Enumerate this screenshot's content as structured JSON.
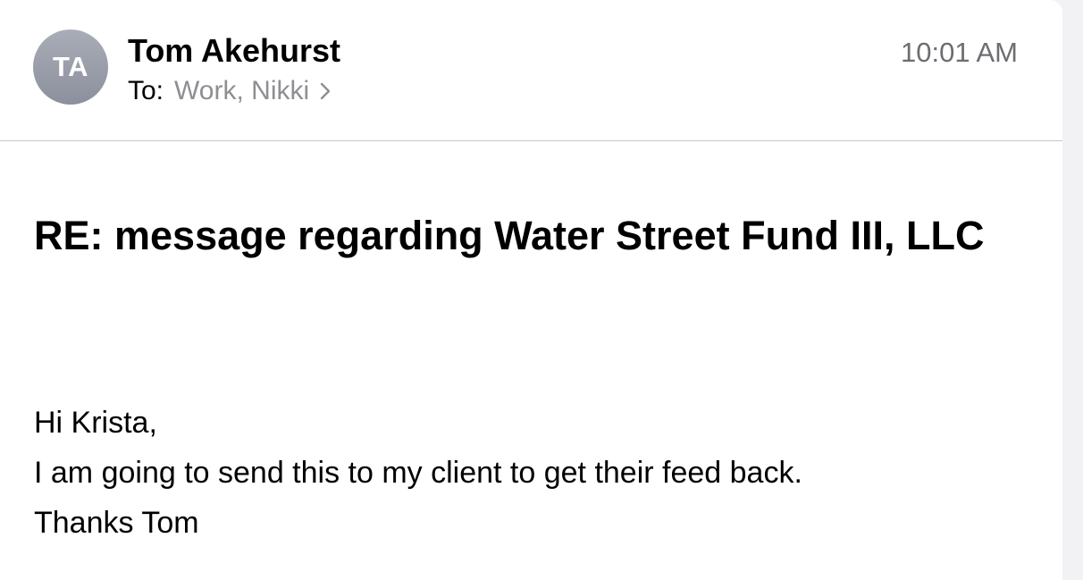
{
  "email": {
    "avatar_initials": "TA",
    "sender_name": "Tom Akehurst",
    "to_label": "To:",
    "recipients": "Work, Nikki",
    "time": "10:01 AM",
    "subject": "RE: message regarding Water Street Fund III, LLC",
    "body_lines": [
      "Hi Krista,",
      "I am going to send this to my client to get their feed back.",
      "Thanks Tom"
    ]
  },
  "colors": {
    "secondary_text": "#8e8e93",
    "avatar_bg": "#9a9ea9",
    "divider": "#c8c8cc"
  },
  "icons": {
    "recipients_disclosure": "chevron-right-icon"
  }
}
